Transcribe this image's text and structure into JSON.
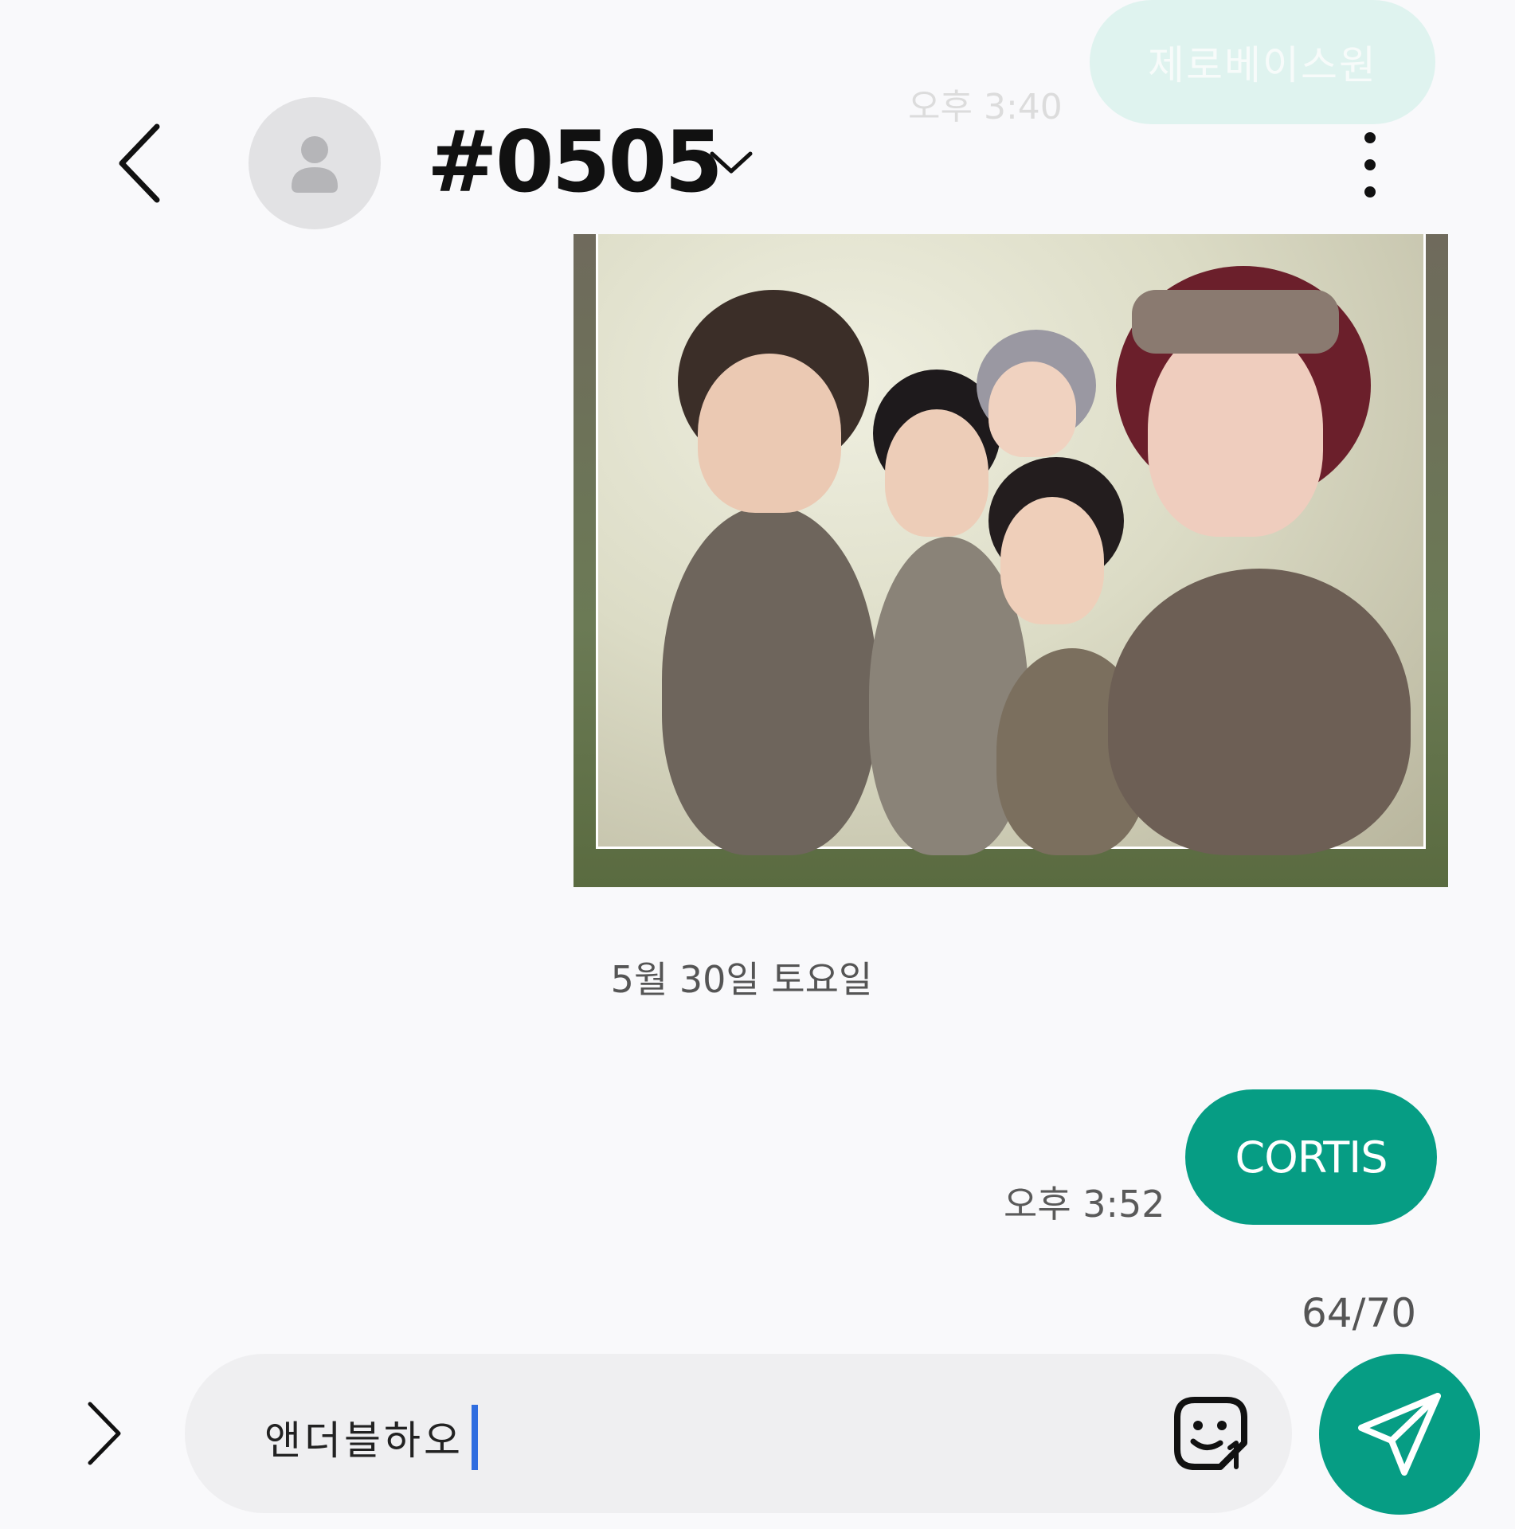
{
  "faded_previous": {
    "bubble_text": "제로베이스원",
    "time": "오후 3:40"
  },
  "header": {
    "title": "#0505",
    "back_icon": "chevron-left-icon",
    "dropdown_icon": "chevron-down-icon",
    "more_icon": "more-vertical-icon",
    "avatar_icon": "person-icon"
  },
  "photo_message": {
    "description_icon": "photo"
  },
  "date_separator": "5월 30일 토요일",
  "sent_message": {
    "text": "CORTIS",
    "time": "오후 3:52",
    "bubble_color": "#069d84"
  },
  "composer": {
    "char_count": "64/70",
    "input_value": "앤더블하오",
    "expand_icon": "chevron-right-icon",
    "sticker_icon": "sticker-icon",
    "send_icon": "send-icon",
    "accent_color": "#069d84",
    "caret_color": "#2f6de0"
  }
}
